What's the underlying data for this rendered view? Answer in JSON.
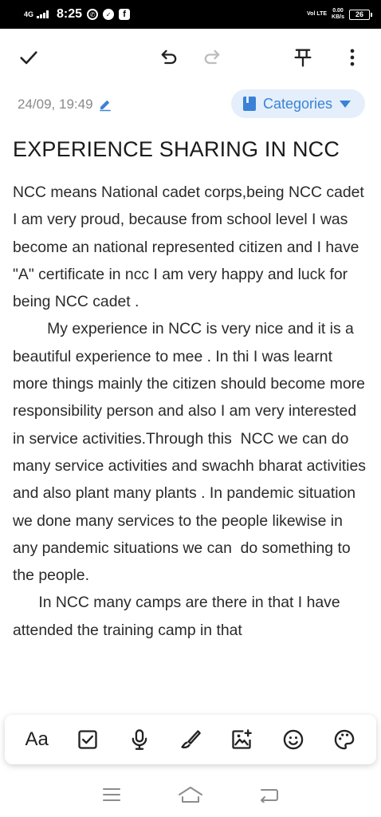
{
  "status_bar": {
    "network": "4G",
    "time": "8:25",
    "data_speed": "0.00",
    "data_unit": "KB/s",
    "lte_label": "Vol LTE",
    "battery": "26"
  },
  "toolbar": {
    "icons": [
      "check-icon",
      "undo-icon",
      "redo-icon",
      "pin-icon",
      "more-vert-icon"
    ]
  },
  "note": {
    "date": "24/09, 19:49",
    "categories_label": "Categories",
    "title": "EXPERIENCE SHARING IN NCC",
    "body": "NCC means National cadet corps,being NCC cadet  I am very proud, because from school level I was become an national represented citizen and I have \"A\" certificate in ncc I am very happy and luck for being NCC cadet .\n        My experience in NCC is very nice and it is a beautiful experience to mee . In thi I was learnt more things mainly the citizen should become more responsibility person and also I am very interested in service activities.Through this  NCC we can do many service activities and swachh bharat activities and also plant many plants . In pandemic situation we done many services to the people likewise in any pandemic situations we can  do something to the people.\n      In NCC many camps are there in that I have attended the training camp in that"
  },
  "bottom_toolbar": {
    "text_format_label": "Aa",
    "icons": [
      "text-format-icon",
      "checkbox-icon",
      "mic-icon",
      "brush-icon",
      "add-image-icon",
      "emoji-icon",
      "palette-icon"
    ]
  },
  "nav_bar": {
    "icons": [
      "menu-icon",
      "home-icon",
      "back-icon"
    ]
  },
  "colors": {
    "accent": "#3b82d6",
    "category_bg": "#e4effb",
    "status_bar_bg": "#000000"
  }
}
